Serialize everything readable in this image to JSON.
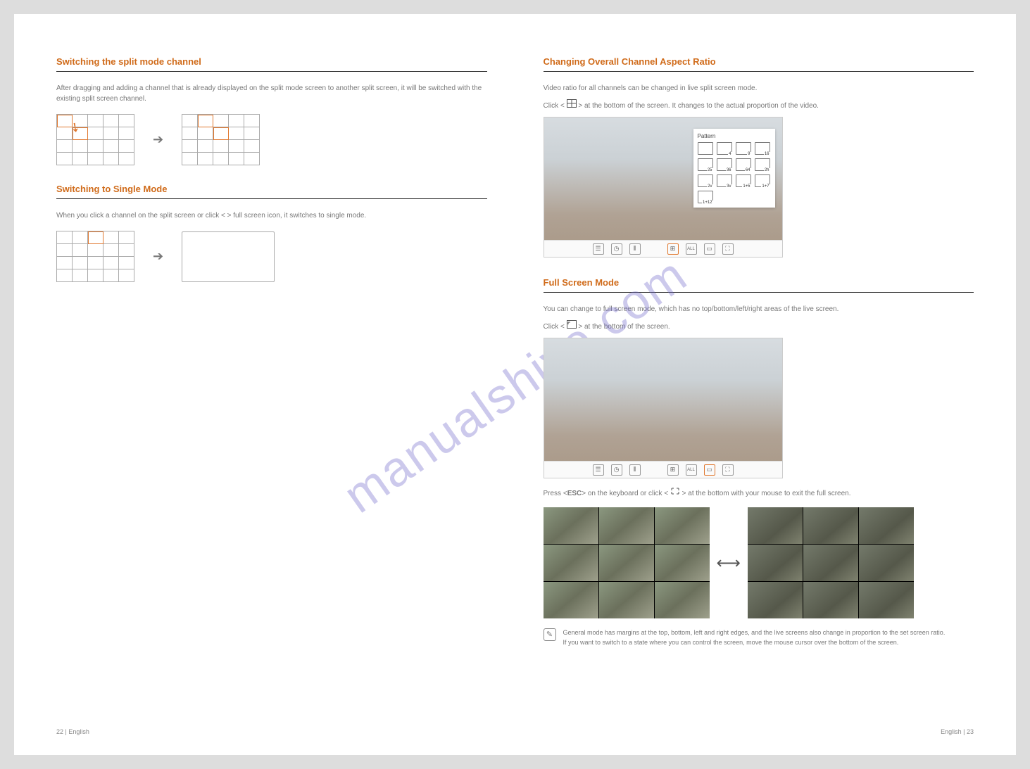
{
  "left": {
    "sec1": {
      "title": "Switching the split mode channel",
      "desc": "After dragging and adding a channel that is already displayed on the split mode screen to another split screen, it will be switched with the existing split screen channel."
    },
    "sec2": {
      "title": "Switching to Single Mode",
      "desc": "When you click a channel on the split screen or click < > full screen icon, it switches to single mode."
    }
  },
  "right": {
    "sec3": {
      "title": "Changing Overall Channel Aspect Ratio",
      "line1": "Video ratio for all channels can be changed in live split screen mode.",
      "line2_a": "Click < ",
      "line2_b": " > at the bottom of the screen. It changes to the actual proportion of the video."
    },
    "sec4": {
      "title": "Full Screen Mode",
      "line1": "You can change to full screen mode, which has no top/bottom/left/right areas of the live screen.",
      "line2_a": "Click < ",
      "line2_b": " > at the bottom of the screen.",
      "line3_a": "Press <",
      "line3_b": "ESC",
      "line3_c": "> on the keyboard or click < ",
      "line3_d": " > at the bottom with your mouse to exit the full screen."
    },
    "pattern_popup_title": "Pattern",
    "toolbar_all": "ALL"
  },
  "notes": {
    "n1": "General mode has margins at the top, bottom, left and right edges, and the live screens also change in proportion to the set screen ratio.",
    "n2": "If you want to switch to a state where you can control the screen, move the mouse cursor over the bottom of the screen."
  },
  "footer": {
    "left": "22 | English",
    "right": "English | 23"
  },
  "watermark": "manualshive.com"
}
